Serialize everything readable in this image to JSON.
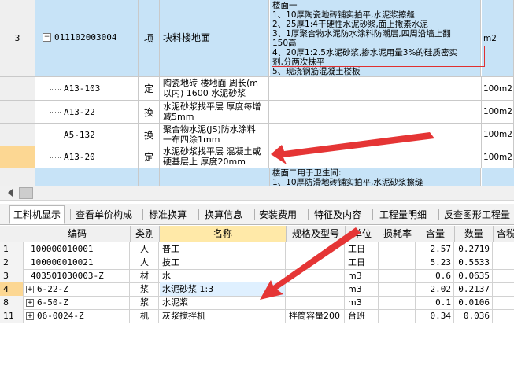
{
  "top_rows": [
    {
      "row_no": "3",
      "code": "011102003004",
      "type": "项",
      "name": "块料楼地面",
      "desc_lines": [
        "楼面一",
        "1、10厚陶瓷地砖铺实拍平,水泥浆擦缝",
        "2、25厚1:4干硬性水泥砂浆,面上撒素水泥",
        "3、1厚聚合物水泥防水涂料防潮层,四周沿墙上翻",
        "150高",
        "4、20厚1:2.5水泥砂浆,掺水泥用量3%的硅质密实",
        "剂,分两次抹平",
        "5、现浇钢筋混凝土楼板"
      ],
      "unit": "m2"
    },
    {
      "row_no": "",
      "code": "A13-103",
      "type": "定",
      "name": "陶瓷地砖 楼地面 周长(m以内) 1600 水泥砂浆",
      "unit": "100m2"
    },
    {
      "row_no": "",
      "code": "A13-22",
      "type": "换",
      "name": "水泥砂浆找平层 厚度每增减5mm",
      "unit": "100m2"
    },
    {
      "row_no": "",
      "code": "A5-132",
      "type": "换",
      "name": "聚合物水泥(JS)防水涂料 一布四涂1mm",
      "unit": "100m2"
    },
    {
      "row_no": "",
      "code": "A13-20",
      "type": "定",
      "name": "水泥砂浆找平层 混凝土或硬基层上 厚度20mm",
      "unit": "100m2"
    },
    {
      "row_no": "",
      "code": "",
      "type": "",
      "name": "",
      "desc_lines": [
        "楼面二用于卫生间:",
        "1、10厚防滑地砖铺实拍平,水泥砂浆擦缝"
      ],
      "unit": ""
    }
  ],
  "tabs": [
    "工料机显示",
    "查看单价构成",
    "标准换算",
    "换算信息",
    "安装费用",
    "特征及内容",
    "工程量明细",
    "反查图形工程量"
  ],
  "bottom": {
    "headers": [
      "编码",
      "类别",
      "名称",
      "规格及型号",
      "单位",
      "损耗率",
      "含量",
      "数量",
      "含税"
    ],
    "rows": [
      {
        "no": "1",
        "expand": false,
        "code": "100000010001",
        "cat": "人",
        "name": "普工",
        "spec": "",
        "unit": "工日",
        "loss": "",
        "qty": "2.57",
        "amount": "0.2719"
      },
      {
        "no": "2",
        "expand": false,
        "code": "100000010021",
        "cat": "人",
        "name": "技工",
        "spec": "",
        "unit": "工日",
        "loss": "",
        "qty": "5.23",
        "amount": "0.5533"
      },
      {
        "no": "3",
        "expand": false,
        "code": "403501030003-Z",
        "cat": "材",
        "name": "水",
        "spec": "",
        "unit": "m3",
        "loss": "",
        "qty": "0.6",
        "amount": "0.0635"
      },
      {
        "no": "4",
        "expand": true,
        "code": "6-22-Z",
        "cat": "浆",
        "name": "水泥砂浆 1:3",
        "spec": "",
        "unit": "m3",
        "loss": "",
        "qty": "2.02",
        "amount": "0.2137"
      },
      {
        "no": "8",
        "expand": true,
        "code": "6-50-Z",
        "cat": "浆",
        "name": "水泥浆",
        "spec": "",
        "unit": "m3",
        "loss": "",
        "qty": "0.1",
        "amount": "0.0106"
      },
      {
        "no": "11",
        "expand": true,
        "code": "06-0024-Z",
        "cat": "机",
        "name": "灰浆搅拌机",
        "spec": "拌筒容量200",
        "unit": "台班",
        "loss": "",
        "qty": "0.34",
        "amount": "0.036"
      }
    ]
  },
  "colors": {
    "selected_row": "#fcd793",
    "highlight_blue": "#c7e3f7",
    "annotation_red": "#e03030"
  }
}
